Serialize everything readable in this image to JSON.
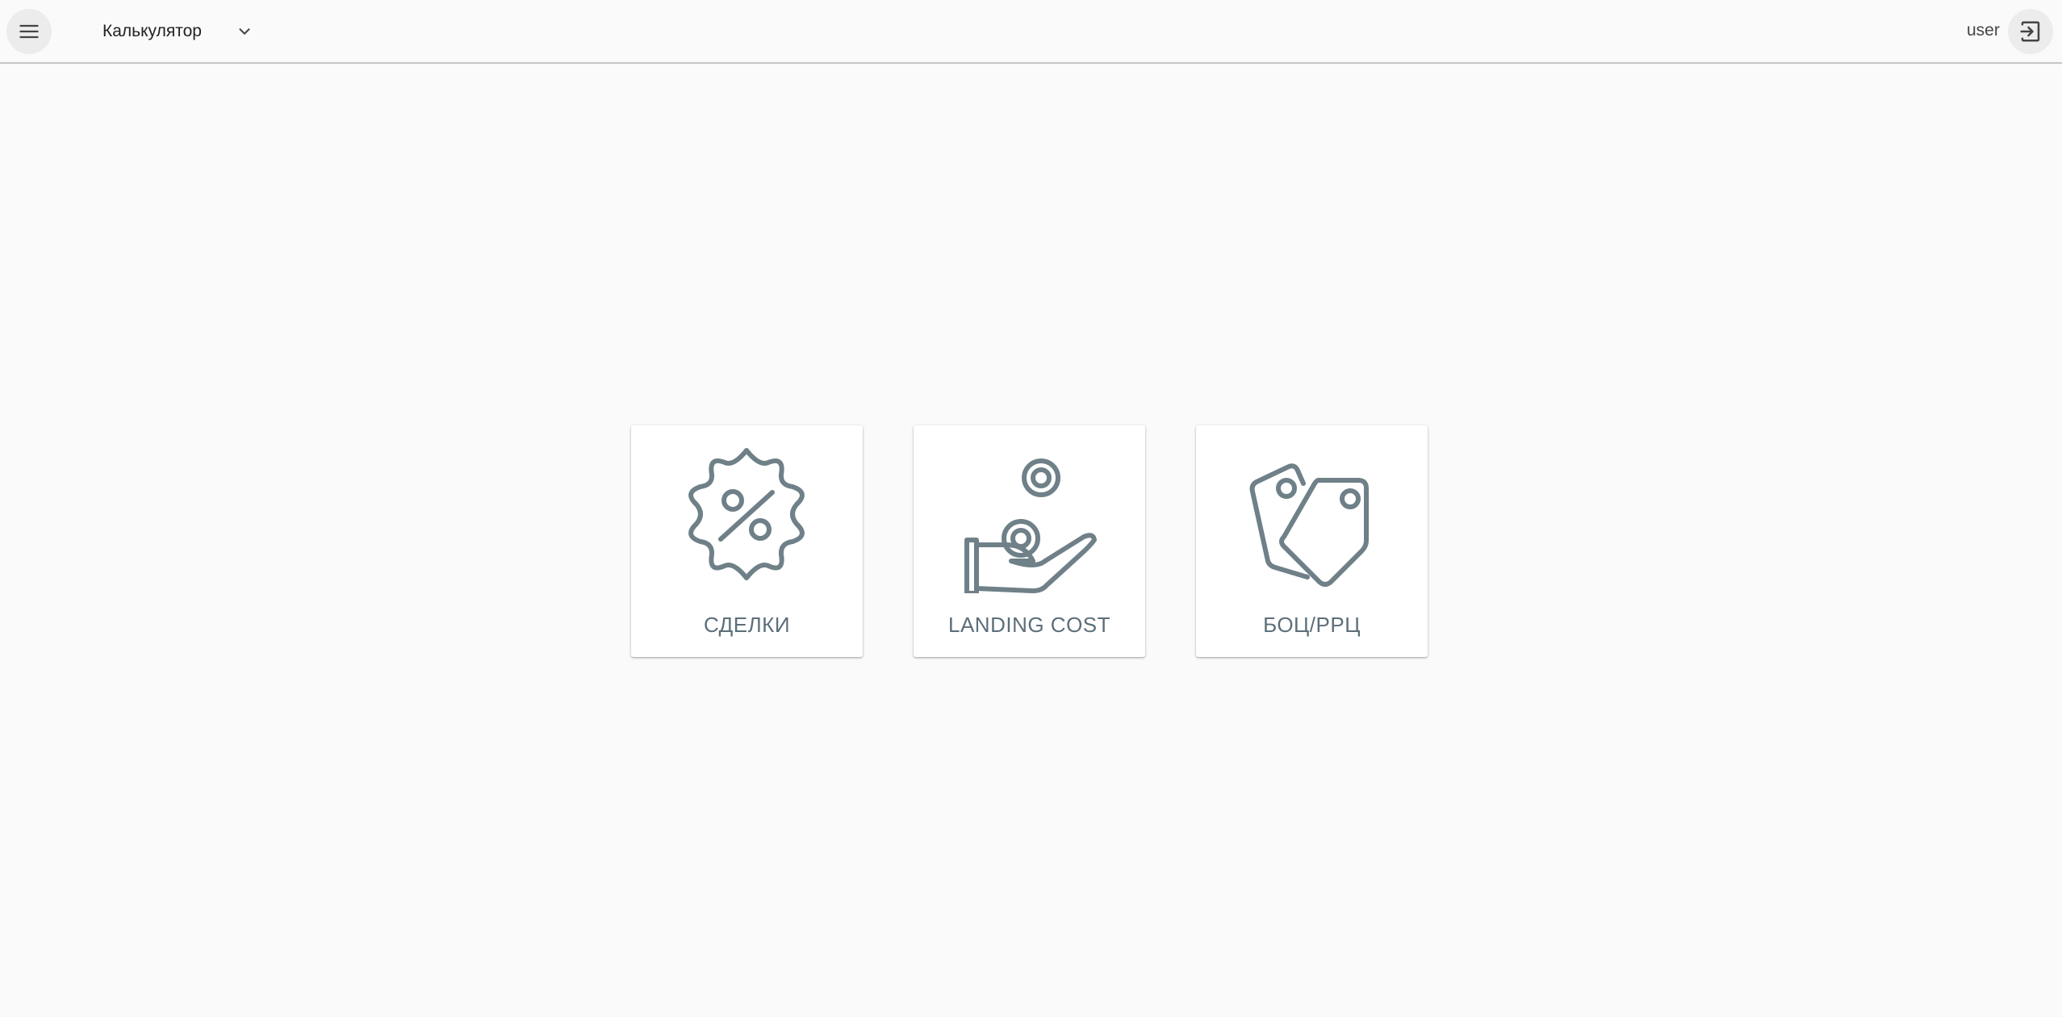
{
  "header": {
    "module_label": "Калькулятор",
    "user_name": "user",
    "menu_icon": "menu-icon",
    "dropdown_icon": "chevron-down-icon",
    "logout_icon": "logout-icon"
  },
  "cards": [
    {
      "label": "СДЕЛКИ",
      "icon": "discount-badge-icon"
    },
    {
      "label": "LANDING COST",
      "icon": "hand-coins-icon"
    },
    {
      "label": "БОЦ/РРЦ",
      "icon": "price-tags-icon"
    }
  ],
  "colors": {
    "icon_stroke": "#6f8088",
    "card_label": "#5c6e79",
    "background": "#fafafa"
  }
}
